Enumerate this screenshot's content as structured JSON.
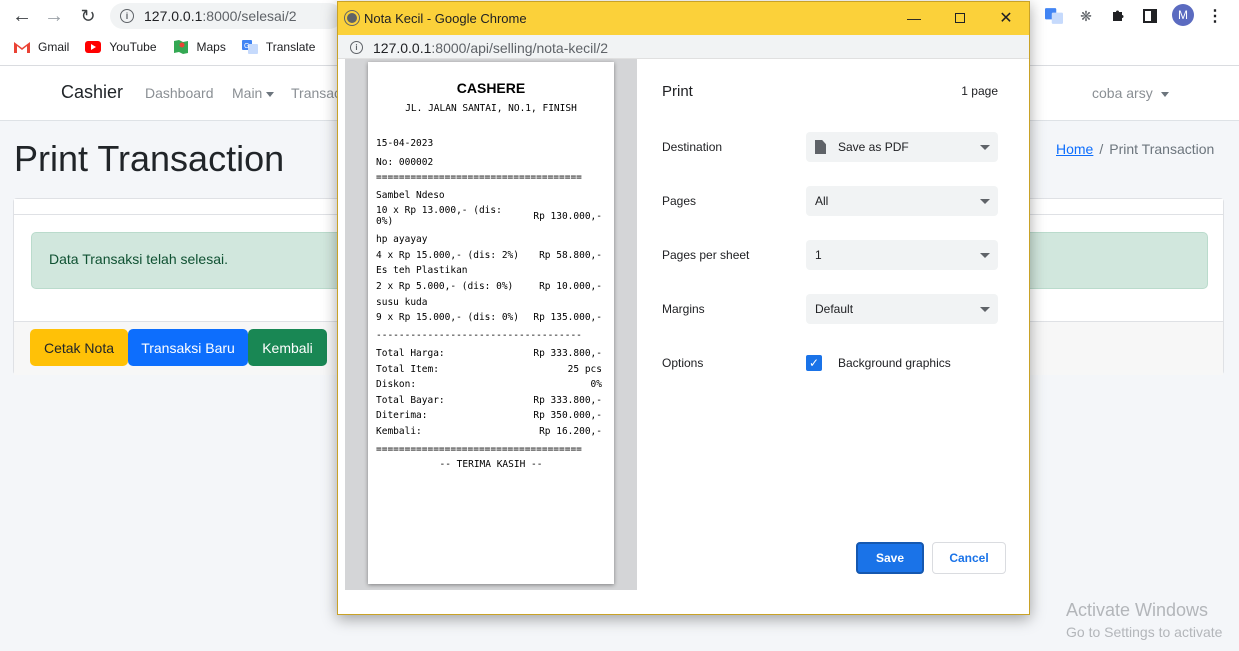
{
  "browser": {
    "url_host": "127.0.0.1",
    "url_path": ":8000/selesai/2",
    "bookmarks": [
      {
        "label": "Gmail",
        "icon": "gmail-icon"
      },
      {
        "label": "YouTube",
        "icon": "youtube-icon"
      },
      {
        "label": "Maps",
        "icon": "maps-icon"
      },
      {
        "label": "Translate",
        "icon": "translate-icon"
      }
    ],
    "profile_initial": "M"
  },
  "app": {
    "brand": "Cashier",
    "nav": {
      "dashboard": "Dashboard",
      "main": "Main",
      "transaction": "Transac"
    },
    "user": "coba arsy",
    "page_title": "Print Transaction",
    "breadcrumb": {
      "home": "Home",
      "separator": "/",
      "current": "Print Transaction"
    },
    "alert": "Data Transaksi telah selesai.",
    "buttons": {
      "print": "Cetak Nota",
      "new": "Transaksi Baru",
      "back": "Kembali"
    }
  },
  "popup": {
    "title": "Nota Kecil - Google Chrome",
    "url_host": "127.0.0.1",
    "url_path": ":8000/api/selling/nota-kecil/2",
    "receipt": {
      "store": "CASHERE",
      "address": "JL. JALAN SANTAI, NO.1, FINISH",
      "date": "15-04-2023",
      "number": "No: 000002",
      "separator_double": "====================================",
      "separator_single": "------------------------------------",
      "items": [
        {
          "name": "Sambel Ndeso",
          "detail": "10 x Rp 13.000,- (dis:\n0%)",
          "total": "Rp 130.000,-"
        },
        {
          "name": "hp ayayay",
          "detail": "4 x Rp 15.000,- (dis: 2%)",
          "total": "Rp 58.800,-"
        },
        {
          "name": "Es teh Plastikan",
          "detail": "2 x Rp 5.000,- (dis: 0%)",
          "total": "Rp 10.000,-"
        },
        {
          "name": "susu kuda",
          "detail": "9 x Rp 15.000,- (dis: 0%)",
          "total": "Rp 135.000,-"
        }
      ],
      "summary": [
        {
          "label": "Total Harga:",
          "value": "Rp 333.800,-"
        },
        {
          "label": "Total Item:",
          "value": "25 pcs"
        },
        {
          "label": "Diskon:",
          "value": "0%"
        },
        {
          "label": "Total Bayar:",
          "value": "Rp 333.800,-"
        },
        {
          "label": "Diterima:",
          "value": "Rp 350.000,-"
        },
        {
          "label": "Kembali:",
          "value": "Rp 16.200,-"
        }
      ],
      "footer": "-- TERIMA KASIH --"
    },
    "print": {
      "heading": "Print",
      "page_count": "1 page",
      "destination_label": "Destination",
      "destination_value": "Save as PDF",
      "pages_label": "Pages",
      "pages_value": "All",
      "per_sheet_label": "Pages per sheet",
      "per_sheet_value": "1",
      "margins_label": "Margins",
      "margins_value": "Default",
      "options_label": "Options",
      "background_graphics": "Background graphics",
      "background_graphics_checked": true,
      "save": "Save",
      "cancel": "Cancel"
    }
  },
  "watermark": {
    "line1": "Activate Windows",
    "line2": "Go to Settings to activate"
  }
}
